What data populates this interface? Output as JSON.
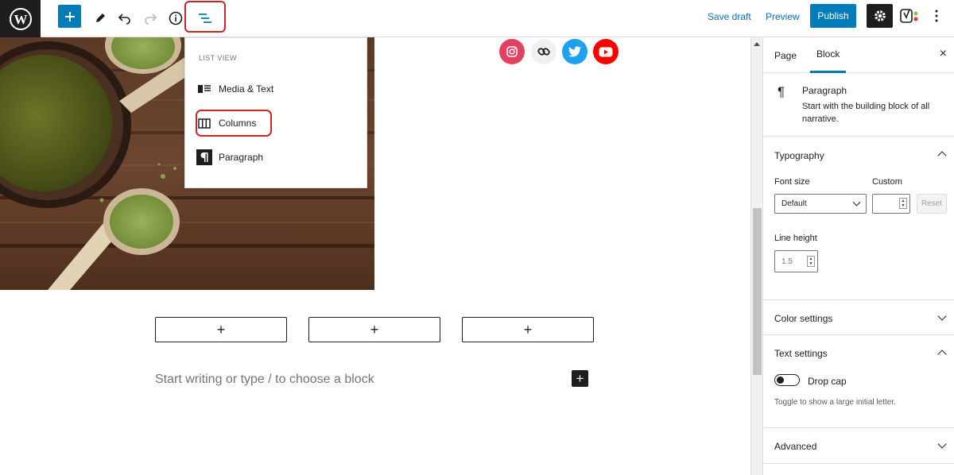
{
  "toolbar": {
    "save_draft": "Save draft",
    "preview": "Preview",
    "publish": "Publish"
  },
  "list_view": {
    "title": "LIST VIEW",
    "items": [
      {
        "label": "Media & Text",
        "icon": "media-text-icon"
      },
      {
        "label": "Columns",
        "icon": "columns-icon"
      },
      {
        "label": "Paragraph",
        "icon": "paragraph-icon"
      }
    ]
  },
  "social_icons": [
    {
      "name": "instagram-icon",
      "color": "#e4405f"
    },
    {
      "name": "link-icon",
      "color": "#f0f0f0"
    },
    {
      "name": "twitter-icon",
      "color": "#1da1f2"
    },
    {
      "name": "youtube-icon",
      "color": "#ff0000"
    }
  ],
  "editor": {
    "column_add_label": "+",
    "placeholder": "Start writing or type / to choose a block",
    "inline_add": "+"
  },
  "sidebar": {
    "tabs": [
      "Page",
      "Block"
    ],
    "active_tab": "Block",
    "close": "×",
    "block": {
      "name": "Paragraph",
      "icon": "¶",
      "description": "Start with the building block of all narrative."
    },
    "typography": {
      "title": "Typography",
      "font_size_label": "Font size",
      "custom_label": "Custom",
      "font_size_value": "Default",
      "reset": "Reset",
      "line_height_label": "Line height",
      "line_height_value": "1.5"
    },
    "color_settings": "Color settings",
    "text_settings": {
      "title": "Text settings",
      "drop_cap": "Drop cap",
      "help": "Toggle to show a large initial letter."
    },
    "advanced": "Advanced"
  },
  "colors": {
    "accent": "#007cba",
    "highlight": "#c62828",
    "dark": "#1e1e1e"
  }
}
